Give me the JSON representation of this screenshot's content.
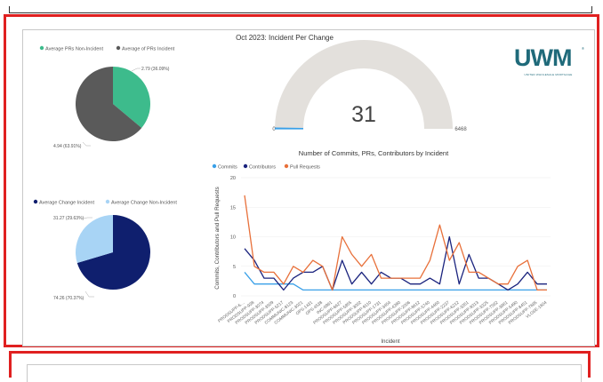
{
  "dashboard_title": "Oct 2023: Incident Per Change",
  "logo": {
    "text": "UWM",
    "tm": "®",
    "subtitle": "UNITED WHOLESALE MORTGAGE"
  },
  "colors": {
    "accent_red": "#e02020",
    "commits": "#3aa0e8",
    "contributors": "#1a237e",
    "pull_requests": "#e8703a",
    "pr_non_incident": "#3dbb8c",
    "pr_incident": "#5a5a5a",
    "change_incident": "#0f1f6e",
    "change_non_incident": "#a8d4f5",
    "gauge_fill": "#e3e0dc"
  },
  "pie1": {
    "legend": [
      "Average PRs Non-Incident",
      "Average of PRs Incident"
    ],
    "slices": [
      {
        "label": "2.79 (36.09%)",
        "value": 2.79,
        "percent": 36.09
      },
      {
        "label": "4.94 (63.91%)",
        "value": 4.94,
        "percent": 63.91
      }
    ]
  },
  "gauge": {
    "value_text": "31",
    "min_text": "0",
    "max_text": "6468",
    "value": 31,
    "min": 0,
    "max": 6468
  },
  "pie2": {
    "legend": [
      "Average Change Incident",
      "Average Change Non-Incident"
    ],
    "slices": [
      {
        "label": "74.26 (70.37%)",
        "value": 74.26,
        "percent": 70.37
      },
      {
        "label": "31.27 (29.63%)",
        "value": 31.27,
        "percent": 29.63
      }
    ]
  },
  "chart_data": {
    "type": "line",
    "title": "Number of Commits, PRs, Contributors by Incident",
    "xlabel": "Incident",
    "ylabel": "Commits, Contributors and Pull Requests",
    "ylim": [
      0,
      20
    ],
    "yticks": [
      0,
      5,
      10,
      15,
      20
    ],
    "legend": [
      "Commits",
      "Contributors",
      "Pull Requests"
    ],
    "categories": [
      "PRODSUPP-6…",
      "PRODSUPP-938",
      "PRODSUPP-3074",
      "PRODSUPP-3509",
      "PRODSUPP-5217",
      "COMMUNIC-8123",
      "COMMUNIC-3021",
      "OPS-1431",
      "OPS-4538",
      "INC-0961",
      "PRODSUPP-6627",
      "PRODSUPP-5855",
      "PRODSUPP-3002",
      "PRODSUPP-9110",
      "PRODSUPP-1731",
      "PRODSUPP-3454",
      "PRODSUPP-4390",
      "PRODSUPP-2006",
      "PRODSUPP-8612",
      "PRODSUPP-5740",
      "PRODSUPP-4460",
      "PRODSUPP-2237",
      "PRODSUPP-6212",
      "PRODSUPP-3351",
      "PRODSUPP-9313",
      "PRODSUPP-3325",
      "PRODSUPP-7562",
      "PRODSUPP-3961",
      "PRODSUPP-5490",
      "PRODSUPP-8451",
      "PRODSUPP-7685",
      "VLOSE-1604"
    ],
    "series": [
      {
        "name": "Commits",
        "values": [
          4,
          2,
          2,
          2,
          2,
          2,
          1,
          1,
          1,
          1,
          1,
          1,
          1,
          1,
          1,
          1,
          1,
          1,
          1,
          1,
          1,
          1,
          1,
          1,
          1,
          1,
          1,
          1,
          1,
          1,
          1,
          1
        ]
      },
      {
        "name": "Contributors",
        "values": [
          8,
          6,
          3,
          3,
          1,
          3,
          4,
          4,
          5,
          1,
          6,
          2,
          4,
          2,
          4,
          3,
          3,
          2,
          2,
          3,
          2,
          10,
          2,
          7,
          3,
          3,
          2,
          1,
          2,
          4,
          2,
          2
        ]
      },
      {
        "name": "Pull Requests",
        "values": [
          17,
          5,
          4,
          4,
          2,
          5,
          4,
          6,
          5,
          1,
          10,
          7,
          5,
          7,
          3,
          3,
          3,
          3,
          3,
          6,
          12,
          6,
          9,
          4,
          4,
          3,
          2,
          2,
          5,
          6,
          1,
          1
        ]
      }
    ]
  }
}
